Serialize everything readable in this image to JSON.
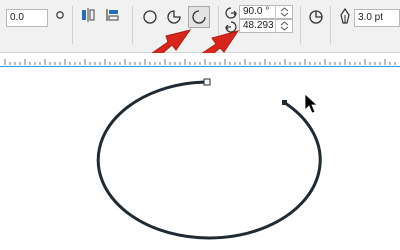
{
  "toolbar": {
    "object_size_value": "0.0",
    "start_angle_value": "90.0 °",
    "end_angle_value": "48.293",
    "outline_width_value": "3.0 pt"
  },
  "icons": {
    "ellipse": "ellipse-icon",
    "pie": "pie-icon",
    "arc": "arc-icon",
    "start_angle": "start-angle-icon",
    "end_angle": "end-angle-icon",
    "direction": "direction-icon",
    "outline_pen": "outline-pen-icon"
  },
  "colors": {
    "annotation_arrow": "#d9261c",
    "ruler_line": "#1ba1e2",
    "ellipse_outline": "#1f2a33",
    "node_handle": "#ffffff"
  }
}
